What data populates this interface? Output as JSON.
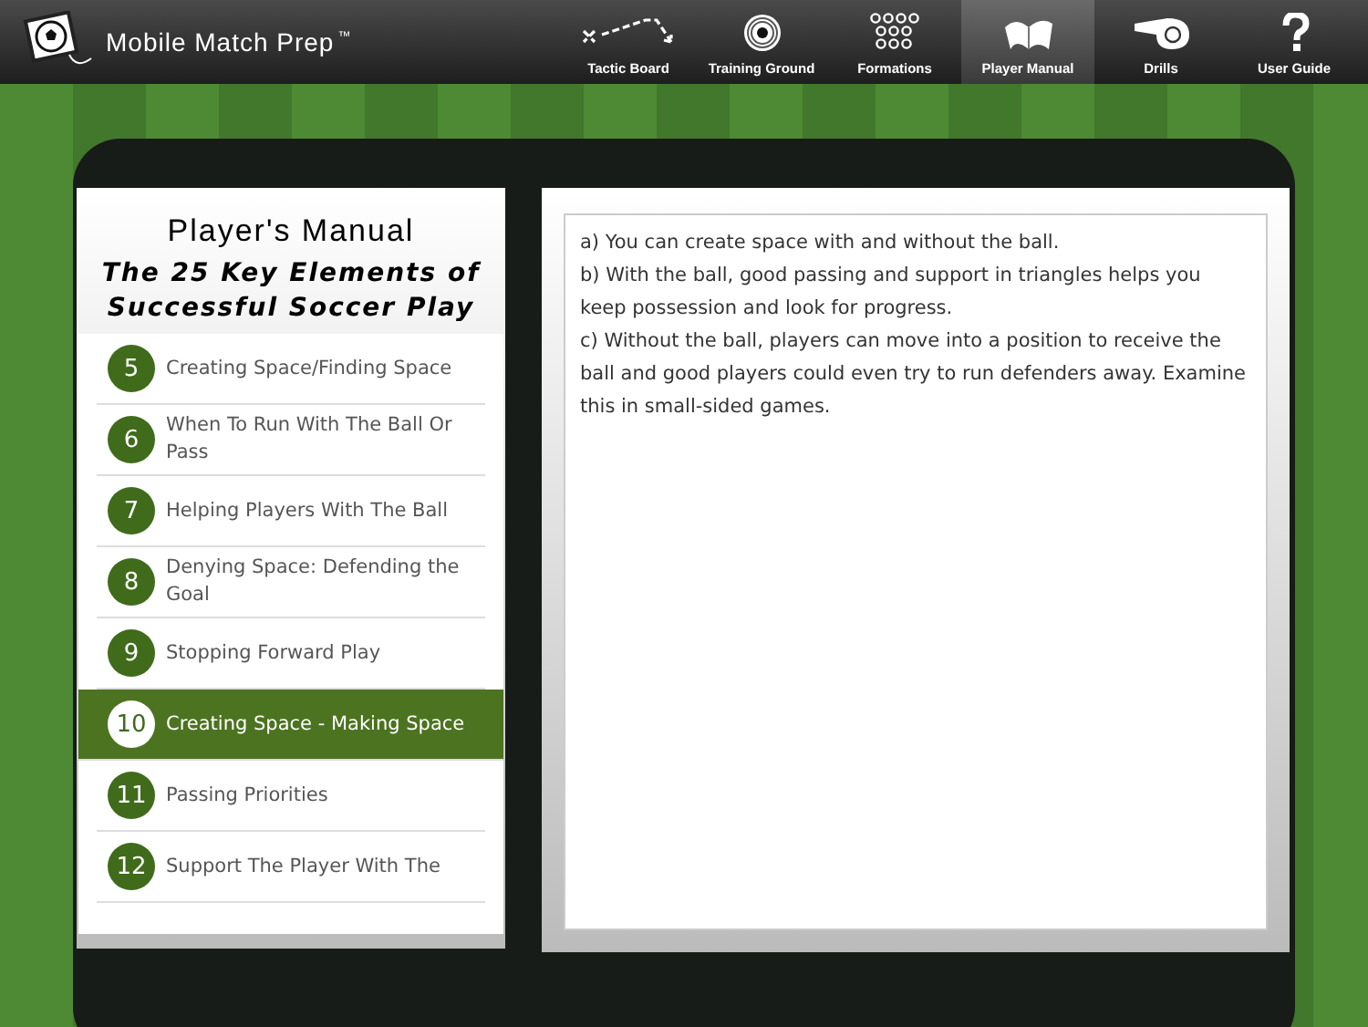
{
  "app": {
    "title": "Mobile Match Prep",
    "trademark": "™"
  },
  "nav": [
    {
      "label": "Tactic Board",
      "kind": "tactic",
      "selected": false
    },
    {
      "label": "Training Ground",
      "kind": "target",
      "selected": false
    },
    {
      "label": "Formations",
      "kind": "dots",
      "selected": false
    },
    {
      "label": "Player Manual",
      "kind": "book",
      "selected": true
    },
    {
      "label": "Drills",
      "kind": "whistle",
      "selected": false
    },
    {
      "label": "User Guide",
      "kind": "help",
      "selected": false
    }
  ],
  "manual": {
    "title": "Player's Manual",
    "subtitle": "The 25 Key Elements of Successful Soccer Play",
    "chapters": [
      {
        "number": "5",
        "title": "Creating Space/Finding Space",
        "selected": false
      },
      {
        "number": "6",
        "title": "When To Run With The Ball Or Pass",
        "selected": false
      },
      {
        "number": "7",
        "title": "Helping Players With The Ball",
        "selected": false
      },
      {
        "number": "8",
        "title": "Denying Space: Defending the Goal",
        "selected": false
      },
      {
        "number": "9",
        "title": "Stopping Forward Play",
        "selected": false
      },
      {
        "number": "10",
        "title": "Creating Space - Making Space",
        "selected": true
      },
      {
        "number": "11",
        "title": "Passing Priorities",
        "selected": false
      },
      {
        "number": "12",
        "title": "Support The Player With The",
        "selected": false
      }
    ]
  },
  "content": {
    "paragraphs": [
      "a) You can create space with and without the ball.",
      "b) With the ball, good passing and support in triangles helps you keep possession and look for progress.",
      "c) Without the ball, players can move into a position to receive the ball and good players could even try to run defenders away. Examine this in small-sided games."
    ]
  }
}
